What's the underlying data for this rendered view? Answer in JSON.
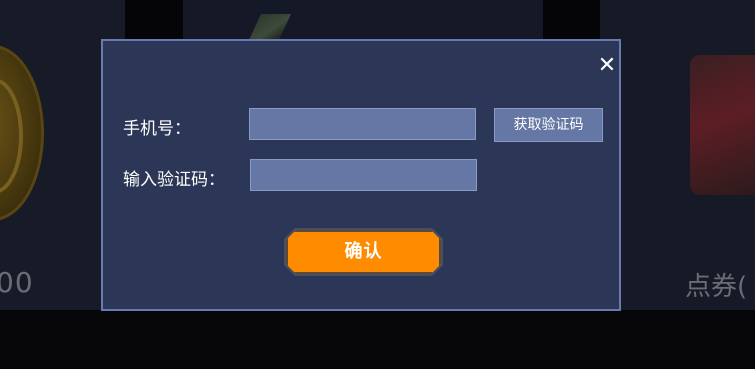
{
  "background": {
    "left_value_text": "00",
    "right_label_text": "点券("
  },
  "dialog": {
    "close_icon": "close-icon",
    "phone_label": "手机号：",
    "phone_value": "",
    "get_code_label": "获取验证码",
    "code_label": "输入验证码：",
    "code_value": "",
    "confirm_label": "确认"
  },
  "colors": {
    "dialog_bg": "#2c3757",
    "dialog_border": "#6a7ab0",
    "input_bg": "#6577a4",
    "confirm_bg": "#ff8c00"
  }
}
